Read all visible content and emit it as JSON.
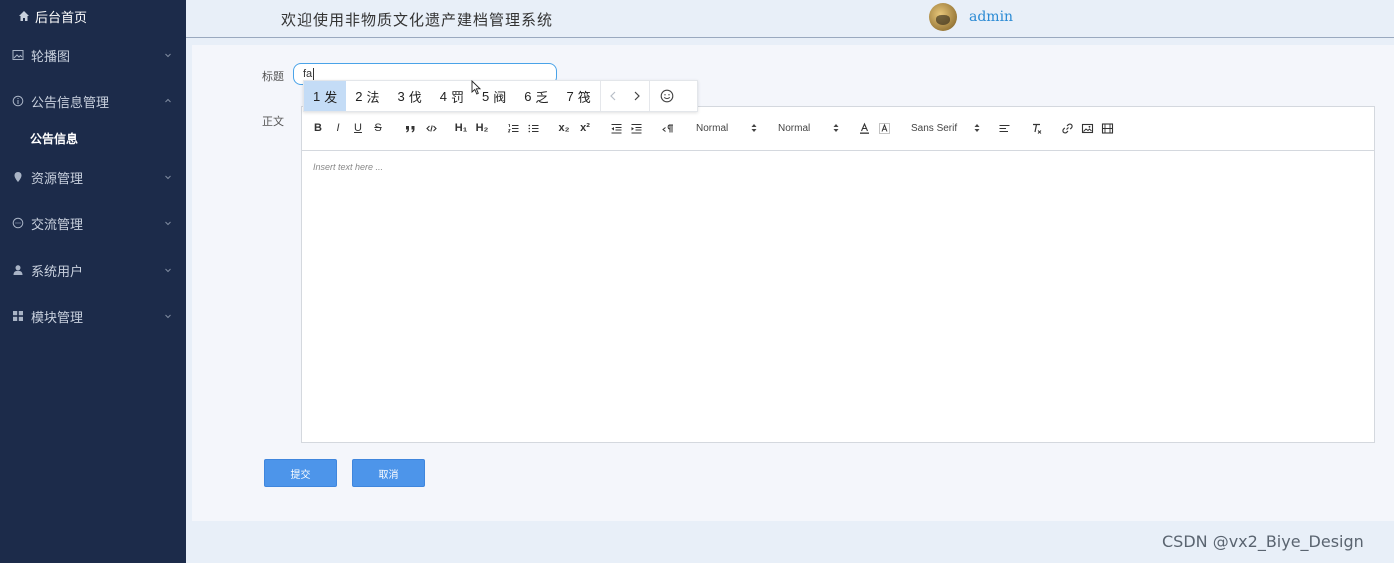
{
  "sidebar": {
    "home": "后台首页",
    "items": [
      {
        "label": "轮播图",
        "icon": "image-icon"
      },
      {
        "label": "公告信息管理",
        "icon": "info-circle-icon"
      },
      {
        "label": "资源管理",
        "icon": "location-pin-icon"
      },
      {
        "label": "交流管理",
        "icon": "chat-bubble-icon"
      },
      {
        "label": "系统用户",
        "icon": "user-icon"
      },
      {
        "label": "模块管理",
        "icon": "grid-icon"
      }
    ],
    "sub_item": "公告信息"
  },
  "header": {
    "title": "欢迎使用非物质文化遗产建档管理系统",
    "username": "admin"
  },
  "form": {
    "title_label": "标题",
    "title_value": "fa",
    "body_label": "正文",
    "editor_placeholder": "Insert text here ...",
    "submit": "提交",
    "cancel": "取消"
  },
  "ime": {
    "candidates": [
      {
        "num": "1",
        "char": "发"
      },
      {
        "num": "2",
        "char": "法"
      },
      {
        "num": "3",
        "char": "伐"
      },
      {
        "num": "4",
        "char": "罚"
      },
      {
        "num": "5",
        "char": "阀"
      },
      {
        "num": "6",
        "char": "乏"
      },
      {
        "num": "7",
        "char": "筏"
      }
    ]
  },
  "toolbar": {
    "bold": "B",
    "italic": "I",
    "underline": "U",
    "strike": "S",
    "h1": "H₁",
    "h2": "H₂",
    "subscript": "x₂",
    "superscript": "x²",
    "header_select": "Normal",
    "size_select": "Normal",
    "font_select": "Sans Serif"
  },
  "watermark": "CSDN @vx2_Biye_Design"
}
